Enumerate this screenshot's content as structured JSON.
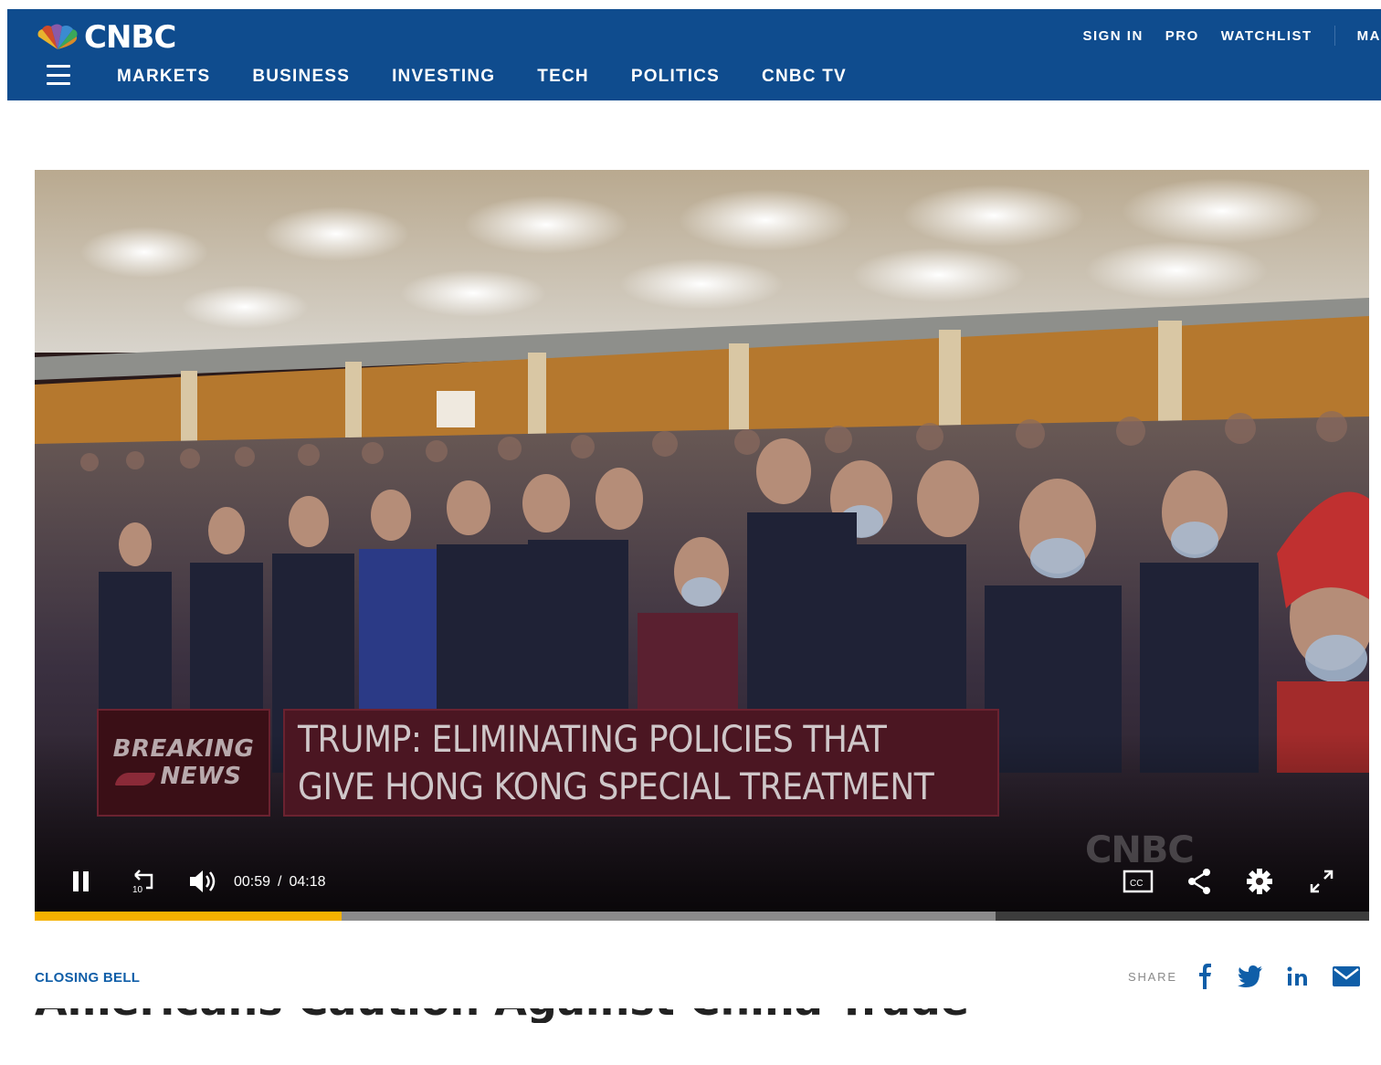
{
  "header": {
    "logo_text": "CNBC",
    "top_links": [
      "SIGN IN",
      "PRO",
      "WATCHLIST",
      "MA"
    ],
    "nav": [
      "MARKETS",
      "BUSINESS",
      "INVESTING",
      "TECH",
      "POLITICS",
      "CNBC TV"
    ]
  },
  "video": {
    "breaking_line1": "BREAKING",
    "breaking_line2": "NEWS",
    "headline_line1": "TRUMP: ELIMINATING POLICIES THAT",
    "headline_line2": "GIVE HONG KONG SPECIAL TREATMENT",
    "watermark": "CNBC",
    "current_time": "00:59",
    "separator": "/",
    "duration": "04:18",
    "progress_fraction": 0.23,
    "buffered_fraction": 0.72
  },
  "article": {
    "section_label": "CLOSING BELL",
    "share_label": "SHARE",
    "headline_partial": "Americans Caution Against China Trade"
  },
  "colors": {
    "header_bg": "#0f4c8e",
    "progress": "#f5b100",
    "section_link": "#0f5ea8",
    "share_icons": "#0f5ea8"
  },
  "icons": [
    "hamburger-icon",
    "pause-icon",
    "replay-10-icon",
    "volume-icon",
    "closed-captions-icon",
    "share-icon",
    "settings-icon",
    "fullscreen-icon",
    "facebook-icon",
    "twitter-icon",
    "linkedin-icon",
    "email-icon"
  ]
}
